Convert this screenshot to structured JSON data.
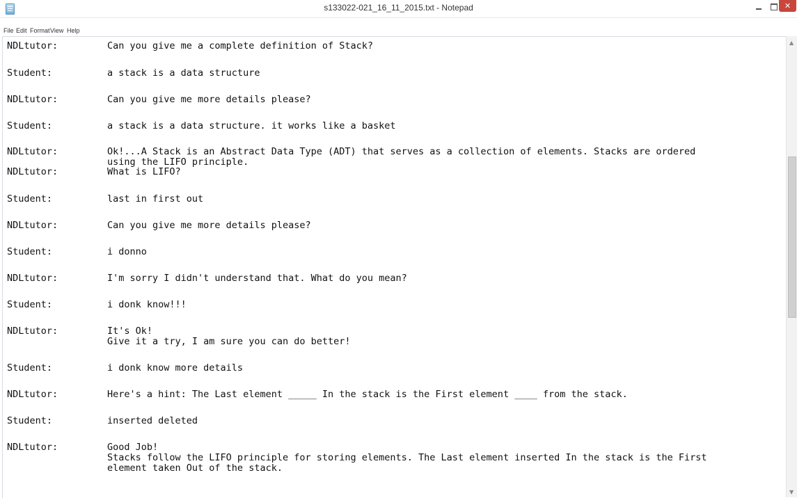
{
  "window": {
    "title": "s133022-021_16_11_2015.txt - Notepad",
    "icon": "notepad-icon",
    "controls": {
      "minimize": "minimize-icon",
      "maximize": "maximize-icon",
      "close_label": "✕"
    }
  },
  "menu": [
    "File",
    "Edit",
    "Format",
    "View",
    "Help"
  ],
  "dialogue": [
    {
      "speaker": "NDLtutor:",
      "text": "Can you give me a complete definition of Stack?"
    },
    {
      "speaker": "Student:",
      "text": "a stack is a data structure"
    },
    {
      "speaker": "NDLtutor:",
      "text": "Can you give me more details please?"
    },
    {
      "speaker": "Student:",
      "text": "a stack is a data structure. it works like a basket"
    },
    {
      "speaker": "NDLtutor:",
      "text": "Ok!...A Stack is an Abstract Data Type (ADT) that serves as a collection of elements. Stacks are ordered",
      "text2": "using the LIFO principle."
    },
    {
      "speaker": "NDLtutor:",
      "text": "What is LIFO?"
    },
    {
      "speaker": "Student:",
      "text": "last in first out"
    },
    {
      "speaker": "NDLtutor:",
      "text": "Can you give me more details please?"
    },
    {
      "speaker": "Student:",
      "text": "i donno"
    },
    {
      "speaker": "NDLtutor:",
      "text": "I'm sorry I didn't understand that. What do you mean?"
    },
    {
      "speaker": "Student:",
      "text": "i donk know!!!"
    },
    {
      "speaker": "NDLtutor:",
      "text": "It's Ok!",
      "text2": "Give it a try, I am sure you can do better!"
    },
    {
      "speaker": "Student:",
      "text": "i donk know more details"
    },
    {
      "speaker": "NDLtutor:",
      "text": "Here's a hint: The Last element _____ In the stack is the First element ____ from the stack."
    },
    {
      "speaker": "Student:",
      "text": "inserted deleted"
    },
    {
      "speaker": "NDLtutor:",
      "text": "Good Job!",
      "text2": "Stacks follow the LIFO principle for storing elements. The Last element inserted In the stack is the First",
      "text3": "element taken Out of the stack."
    }
  ],
  "scrollbar": {
    "up_arrow": "up-arrow-icon",
    "down_arrow": "down-arrow-icon"
  }
}
